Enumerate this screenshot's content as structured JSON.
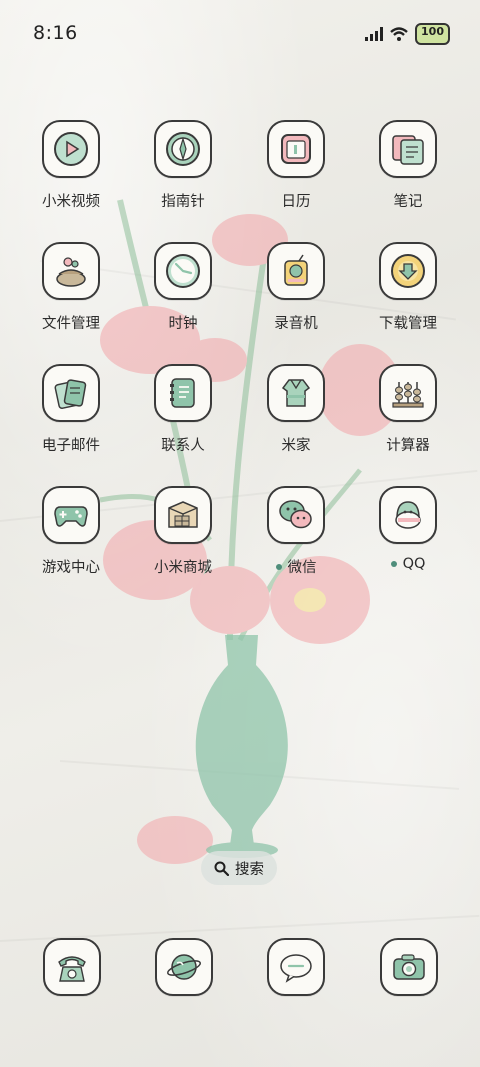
{
  "status_bar": {
    "time": "8:16",
    "battery": "100",
    "icons": [
      "signal-icon",
      "wifi-icon",
      "battery-icon"
    ]
  },
  "apps": [
    {
      "label": "小米视频",
      "icon": "video-icon",
      "has_dot": false
    },
    {
      "label": "指南针",
      "icon": "compass-icon",
      "has_dot": false
    },
    {
      "label": "日历",
      "icon": "calendar-icon",
      "has_dot": false
    },
    {
      "label": "笔记",
      "icon": "notes-icon",
      "has_dot": false
    },
    {
      "label": "文件管理",
      "icon": "file-manager-icon",
      "has_dot": false
    },
    {
      "label": "时钟",
      "icon": "clock-icon",
      "has_dot": false
    },
    {
      "label": "录音机",
      "icon": "recorder-icon",
      "has_dot": false
    },
    {
      "label": "下载管理",
      "icon": "download-icon",
      "has_dot": false
    },
    {
      "label": "电子邮件",
      "icon": "email-icon",
      "has_dot": false
    },
    {
      "label": "联系人",
      "icon": "contacts-icon",
      "has_dot": false
    },
    {
      "label": "米家",
      "icon": "mijia-icon",
      "has_dot": false
    },
    {
      "label": "计算器",
      "icon": "calculator-icon",
      "has_dot": false
    },
    {
      "label": "游戏中心",
      "icon": "gamepad-icon",
      "has_dot": false
    },
    {
      "label": "小米商城",
      "icon": "store-icon",
      "has_dot": false
    },
    {
      "label": "微信",
      "icon": "wechat-icon",
      "has_dot": true
    },
    {
      "label": "QQ",
      "icon": "qq-icon",
      "has_dot": true
    }
  ],
  "search": {
    "label": "搜索",
    "icon": "search-icon"
  },
  "dock": [
    "phone-icon",
    "browser-icon",
    "messages-icon",
    "camera-icon"
  ],
  "colors": {
    "accent_green": "#8fc4aa",
    "dark_green": "#4f8e7b",
    "pink": "#f3b9bd",
    "yellow": "#f3d37a",
    "outline": "#3a3a3a"
  }
}
